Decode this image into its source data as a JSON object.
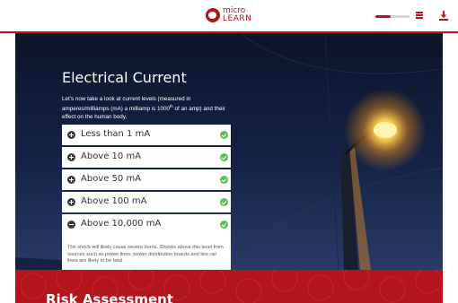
{
  "header": {
    "logo_line1": "micro",
    "logo_line2": "LEARN",
    "progress_fraction": 0.45,
    "menu_icon": "menu-icon",
    "download_icon": "download-icon"
  },
  "section": {
    "title": "Electrical Current",
    "intro_pre": "Let's now take a look at current levels (measured in amperes/milliamps (mA) a milliamp is 1000",
    "intro_sup": "th",
    "intro_post": " of an amp) and their effect on the human body."
  },
  "accordion": {
    "items": [
      {
        "label": "Less than 1 mA",
        "state": "collapsed",
        "completed": true
      },
      {
        "label": "Above 10 mA",
        "state": "collapsed",
        "completed": true
      },
      {
        "label": "Above 50 mA",
        "state": "collapsed",
        "completed": true
      },
      {
        "label": "Above 100 mA",
        "state": "collapsed",
        "completed": true
      },
      {
        "label": "Above 10,000 mA",
        "state": "expanded",
        "completed": true,
        "body": "The shock will likely cause severe burns. Shocks above this level from sources such as power lines, power distribution boards and live rail lines are likely to be fatal."
      }
    ]
  },
  "next_section": {
    "title": "Risk Assessment"
  },
  "colors": {
    "brand_red": "#b0161e",
    "check_green": "#5cbf5a",
    "hero_blue": "#142347"
  }
}
